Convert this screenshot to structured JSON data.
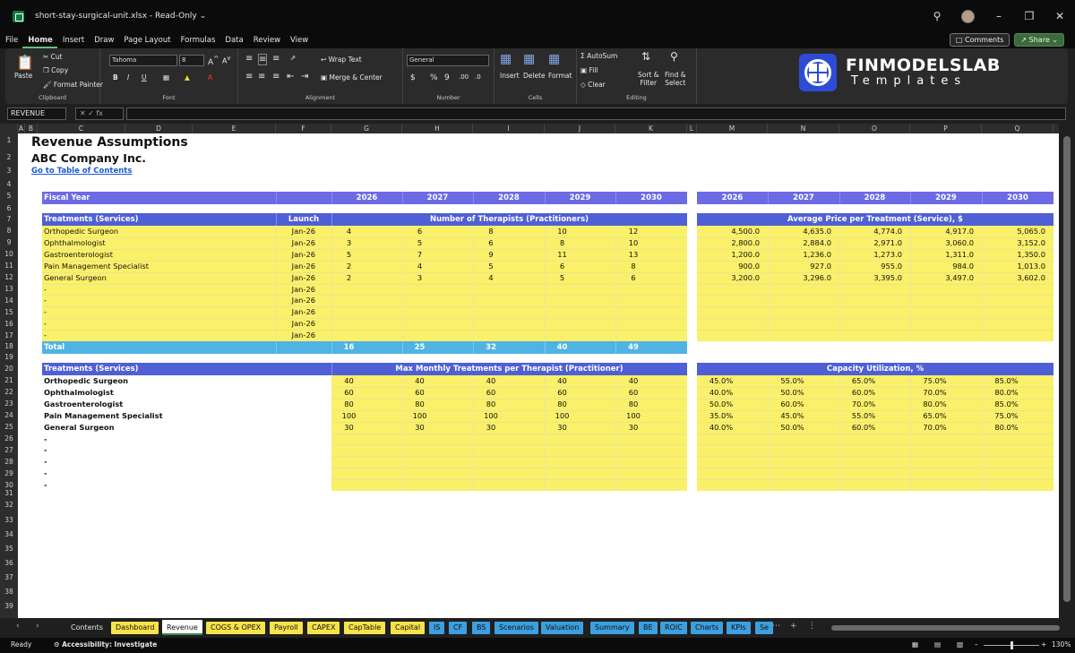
{
  "window": {
    "title": "short-stay-surgical-unit.xlsx  -  Read-Only ⌄"
  },
  "menu": {
    "items": [
      "File",
      "Home",
      "Insert",
      "Draw",
      "Page Layout",
      "Formulas",
      "Data",
      "Review",
      "View"
    ],
    "comments": "Comments",
    "share": "Share ⌄"
  },
  "ribbon": {
    "paste": "Paste",
    "cut": "Cut",
    "copy": "Copy",
    "format_painter": "Format Painter",
    "clipboard": "Clipboard",
    "font_name": "Tahoma",
    "font_size": "8",
    "font_label": "Font",
    "wrap_text": "Wrap Text",
    "merge_center": "Merge & Center",
    "alignment_label": "Alignment",
    "number_format": "General",
    "number_label": "Number",
    "insert": "Insert",
    "delete": "Delete",
    "format": "Format",
    "cells_label": "Cells",
    "autosum": "AutoSum",
    "fill": "Fill",
    "clear": "Clear",
    "sort_filter_1": "Sort &",
    "sort_filter_2": "Filter",
    "find_select_1": "Find &",
    "find_select_2": "Select",
    "editing_label": "Editing",
    "brand_1": "FINMODELSLAB",
    "brand_2": "Templates"
  },
  "formula_bar": {
    "name_box": "REVENUE",
    "fx": "✕  ✓  fx"
  },
  "columns": [
    "A",
    "B",
    "C",
    "D",
    "E",
    "F",
    "G",
    "H",
    "I",
    "J",
    "K",
    "L",
    "M",
    "N",
    "O",
    "P",
    "Q"
  ],
  "rows": [
    "1",
    "2",
    "3",
    "4",
    "5",
    "6",
    "7",
    "8",
    "9",
    "10",
    "11",
    "12",
    "13",
    "14",
    "15",
    "16",
    "17",
    "18",
    "19",
    "20",
    "21",
    "22",
    "23",
    "24",
    "25",
    "26",
    "27",
    "28",
    "29",
    "30",
    "31",
    "32",
    "33",
    "34",
    "35",
    "36",
    "37",
    "38",
    "39"
  ],
  "sheet": {
    "title": "Revenue Assumptions",
    "company": "ABC Company Inc.",
    "toc_link": "Go to Table of Contents",
    "fiscal_year_label": "Fiscal Year",
    "years": [
      "2026",
      "2027",
      "2028",
      "2029",
      "2030"
    ],
    "treatments_label": "Treatments (Services)",
    "launch_label": "Launch",
    "therapists_header": "Number of Therapists (Practitioners)",
    "price_header": "Average Price per Treatment (Service), $",
    "services": [
      {
        "name": "Orthopedic Surgeon",
        "launch": "Jan-26",
        "therapists": [
          "4",
          "6",
          "8",
          "10",
          "12"
        ],
        "price": [
          "4,500.0",
          "4,635.0",
          "4,774.0",
          "4,917.0",
          "5,065.0"
        ]
      },
      {
        "name": "Ophthalmologist",
        "launch": "Jan-26",
        "therapists": [
          "3",
          "5",
          "6",
          "8",
          "10"
        ],
        "price": [
          "2,800.0",
          "2,884.0",
          "2,971.0",
          "3,060.0",
          "3,152.0"
        ]
      },
      {
        "name": "Gastroenterologist",
        "launch": "Jan-26",
        "therapists": [
          "5",
          "7",
          "9",
          "11",
          "13"
        ],
        "price": [
          "1,200.0",
          "1,236.0",
          "1,273.0",
          "1,311.0",
          "1,350.0"
        ]
      },
      {
        "name": "Pain Management Specialist",
        "launch": "Jan-26",
        "therapists": [
          "2",
          "4",
          "5",
          "6",
          "8"
        ],
        "price": [
          "900.0",
          "927.0",
          "955.0",
          "984.0",
          "1,013.0"
        ]
      },
      {
        "name": "General Surgeon",
        "launch": "Jan-26",
        "therapists": [
          "2",
          "3",
          "4",
          "5",
          "6"
        ],
        "price": [
          "3,200.0",
          "3,296.0",
          "3,395.0",
          "3,497.0",
          "3,602.0"
        ]
      },
      {
        "name": "-",
        "launch": "Jan-26",
        "therapists": [
          "",
          "",
          "",
          "",
          ""
        ],
        "price": [
          "",
          "",
          "",
          "",
          ""
        ]
      },
      {
        "name": "-",
        "launch": "Jan-26",
        "therapists": [
          "",
          "",
          "",
          "",
          ""
        ],
        "price": [
          "",
          "",
          "",
          "",
          ""
        ]
      },
      {
        "name": "-",
        "launch": "Jan-26",
        "therapists": [
          "",
          "",
          "",
          "",
          ""
        ],
        "price": [
          "",
          "",
          "",
          "",
          ""
        ]
      },
      {
        "name": "-",
        "launch": "Jan-26",
        "therapists": [
          "",
          "",
          "",
          "",
          ""
        ],
        "price": [
          "",
          "",
          "",
          "",
          ""
        ]
      },
      {
        "name": "-",
        "launch": "Jan-26",
        "therapists": [
          "",
          "",
          "",
          "",
          ""
        ],
        "price": [
          "",
          "",
          "",
          "",
          ""
        ]
      }
    ],
    "total_label": "Total",
    "totals": [
      "16",
      "25",
      "32",
      "40",
      "49"
    ],
    "treatments_label_2": "Treatments (Services)",
    "max_header": "Max Monthly Treatments per Therapist (Practitioner)",
    "capacity_header": "Capacity Utilization, %",
    "services2": [
      {
        "name": "Orthopedic Surgeon",
        "max": [
          "40",
          "40",
          "40",
          "40",
          "40"
        ],
        "cap": [
          "45.0%",
          "55.0%",
          "65.0%",
          "75.0%",
          "85.0%"
        ]
      },
      {
        "name": "Ophthalmologist",
        "max": [
          "60",
          "60",
          "60",
          "60",
          "60"
        ],
        "cap": [
          "40.0%",
          "50.0%",
          "60.0%",
          "70.0%",
          "80.0%"
        ]
      },
      {
        "name": "Gastroenterologist",
        "max": [
          "80",
          "80",
          "80",
          "80",
          "80"
        ],
        "cap": [
          "50.0%",
          "60.0%",
          "70.0%",
          "80.0%",
          "85.0%"
        ]
      },
      {
        "name": "Pain Management Specialist",
        "max": [
          "100",
          "100",
          "100",
          "100",
          "100"
        ],
        "cap": [
          "35.0%",
          "45.0%",
          "55.0%",
          "65.0%",
          "75.0%"
        ]
      },
      {
        "name": "General Surgeon",
        "max": [
          "30",
          "30",
          "30",
          "30",
          "30"
        ],
        "cap": [
          "40.0%",
          "50.0%",
          "60.0%",
          "70.0%",
          "80.0%"
        ]
      },
      {
        "name": "-",
        "max": [
          "",
          "",
          "",
          "",
          ""
        ],
        "cap": [
          "",
          "",
          "",
          "",
          ""
        ]
      },
      {
        "name": "-",
        "max": [
          "",
          "",
          "",
          "",
          ""
        ],
        "cap": [
          "",
          "",
          "",
          "",
          ""
        ]
      },
      {
        "name": "-",
        "max": [
          "",
          "",
          "",
          "",
          ""
        ],
        "cap": [
          "",
          "",
          "",
          "",
          ""
        ]
      },
      {
        "name": "-",
        "max": [
          "",
          "",
          "",
          "",
          ""
        ],
        "cap": [
          "",
          "",
          "",
          "",
          ""
        ]
      },
      {
        "name": "-",
        "max": [
          "",
          "",
          "",
          "",
          ""
        ],
        "cap": [
          "",
          "",
          "",
          "",
          ""
        ]
      }
    ]
  },
  "tabs": [
    {
      "label": "Contents",
      "style": "plain"
    },
    {
      "label": "Dashboard",
      "style": "y"
    },
    {
      "label": "Revenue",
      "style": "active"
    },
    {
      "label": "COGS & OPEX",
      "style": "y"
    },
    {
      "label": "Payroll",
      "style": "y"
    },
    {
      "label": "CAPEX",
      "style": "y"
    },
    {
      "label": "CapTable",
      "style": "y"
    },
    {
      "label": "Capital",
      "style": "y"
    },
    {
      "label": "IS",
      "style": "b"
    },
    {
      "label": "CF",
      "style": "b"
    },
    {
      "label": "BS",
      "style": "b"
    },
    {
      "label": "Scenarios",
      "style": "b"
    },
    {
      "label": "Valuation",
      "style": "b"
    },
    {
      "label": "Summary",
      "style": "b"
    },
    {
      "label": "BE",
      "style": "b"
    },
    {
      "label": "ROIC",
      "style": "b"
    },
    {
      "label": "Charts",
      "style": "b"
    },
    {
      "label": "KPIs",
      "style": "b"
    },
    {
      "label": "Se",
      "style": "b"
    }
  ],
  "status": {
    "ready": "Ready",
    "accessibility": "Accessibility: Investigate",
    "zoom": "130%"
  },
  "colors": {
    "header_blue": "#4f5fd6",
    "fiscal_purple": "#6c6be5",
    "input_yellow": "#faf06a",
    "total_cyan": "#4fb3e3",
    "link_blue": "#1d5ad6"
  }
}
